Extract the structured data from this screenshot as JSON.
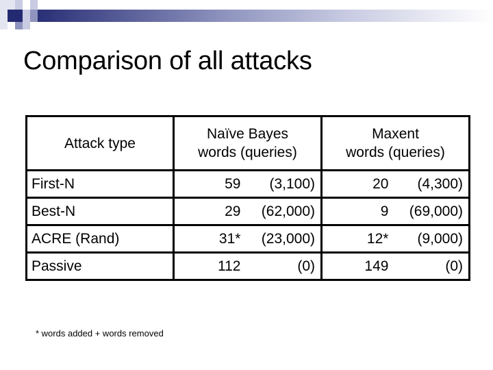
{
  "slide": {
    "title": "Comparison of all attacks",
    "footnote": "* words added + words removed",
    "background_color": "#ffffff",
    "text_color": "#000000"
  },
  "decoration": {
    "accent_dark": "#242a72",
    "accent_mid": "#8f94bf",
    "accent_light": "#c8cbe2",
    "accent_pale": "#e3e5f0",
    "gradient_from": "#242a72",
    "gradient_to": "#ffffff"
  },
  "table": {
    "border_color": "#000000",
    "columns": [
      {
        "key": "attack",
        "header_line1": "Attack type",
        "header_line2": ""
      },
      {
        "key": "naive_bayes",
        "header_line1": "Naïve Bayes",
        "header_line2": "words (queries)"
      },
      {
        "key": "maxent",
        "header_line1": "Maxent",
        "header_line2": "words (queries)"
      }
    ],
    "rows": [
      {
        "attack": "First-N",
        "nb_words": "59",
        "nb_queries": "(3,100)",
        "mx_words": "20",
        "mx_queries": "(4,300)"
      },
      {
        "attack": "Best-N",
        "nb_words": "29",
        "nb_queries": "(62,000)",
        "mx_words": "9",
        "mx_queries": "(69,000)"
      },
      {
        "attack": "ACRE (Rand)",
        "nb_words": "31*",
        "nb_queries": "(23,000)",
        "mx_words": "12*",
        "mx_queries": "(9,000)"
      },
      {
        "attack": "Passive",
        "nb_words": "112",
        "nb_queries": "(0)",
        "mx_words": "149",
        "mx_queries": "(0)"
      }
    ]
  }
}
